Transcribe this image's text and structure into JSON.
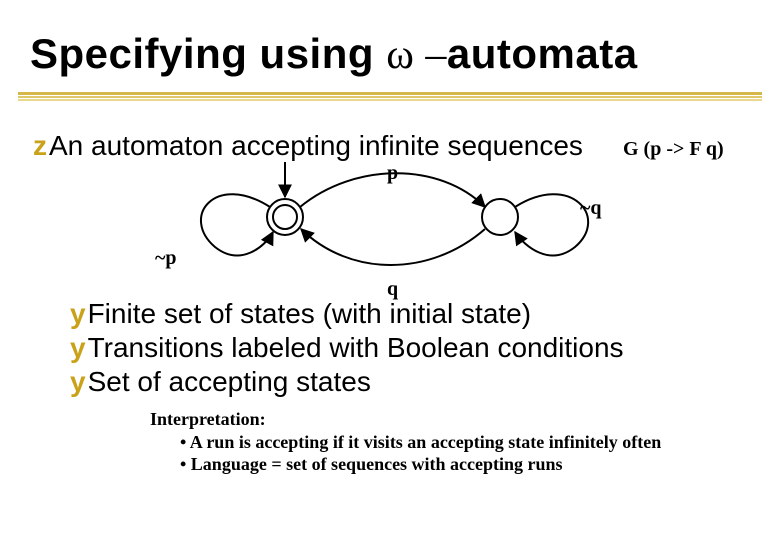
{
  "title": {
    "pre": "Specifying using ",
    "omega": "ω –",
    "post": "automata"
  },
  "bullet_main": {
    "marker": "z",
    "text": "An automaton accepting infinite sequences"
  },
  "formula": "G (p -> F q)",
  "diagram": {
    "label_p": "p",
    "label_q": "q",
    "label_notp": "~p",
    "label_notq": "~q"
  },
  "sub_bullets": {
    "marker": "y",
    "items": [
      "Finite set of states (with initial state)",
      "Transitions labeled with Boolean conditions",
      "Set of accepting states"
    ]
  },
  "interpretation": {
    "heading": "Interpretation:",
    "lines": [
      "• A run is accepting if it visits an accepting state infinitely often",
      "• Language = set of sequences with accepting runs"
    ]
  }
}
